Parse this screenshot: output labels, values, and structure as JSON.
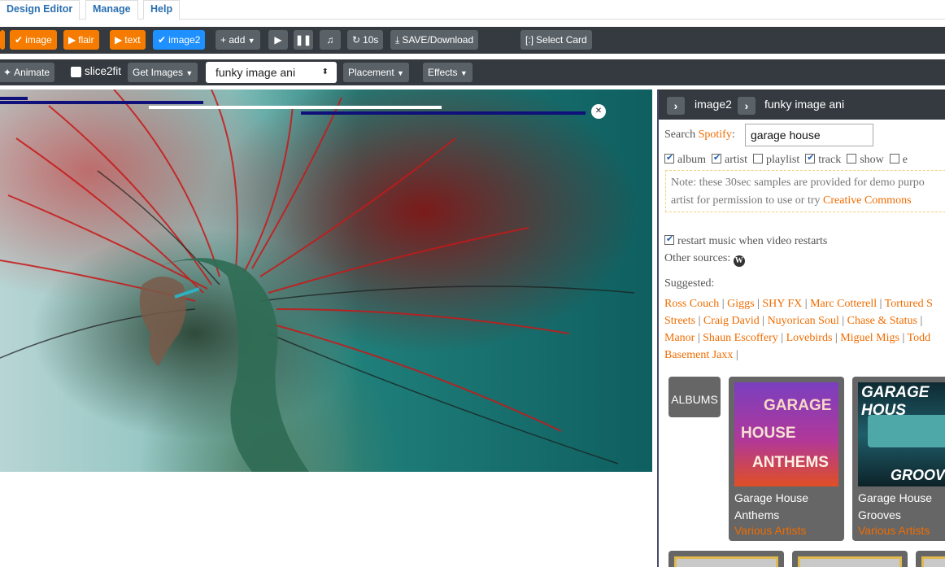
{
  "tabs": [
    "Design Editor",
    "Manage",
    "Help"
  ],
  "toolbar1": {
    "image": "image",
    "flair": "flair",
    "text": "text",
    "image2": "image2",
    "add": "+ add",
    "timer": "10s",
    "save": "SAVE/Download",
    "select_card": "Select Card"
  },
  "toolbar2": {
    "animate": "Animate",
    "slice2fit": "slice2fit",
    "get_images": "Get Images",
    "select_value": "funky image ani",
    "placement": "Placement",
    "effects": "Effects"
  },
  "panel": {
    "breadcrumb1": "image2",
    "breadcrumb2": "funky image ani",
    "search_label": "Search",
    "search_source": "Spotify",
    "search_value": "garage house",
    "filters": [
      {
        "label": "album",
        "checked": true
      },
      {
        "label": "artist",
        "checked": true
      },
      {
        "label": "playlist",
        "checked": false
      },
      {
        "label": "track",
        "checked": true
      },
      {
        "label": "show",
        "checked": false
      },
      {
        "label": "e",
        "checked": false
      }
    ],
    "note_line1": "Note: these 30sec samples are provided for demo purpo",
    "note_line2": "artist for permission to use or try",
    "note_link": "Creative Commons",
    "restart_label": "restart music when video restarts",
    "other_sources": "Other sources:",
    "suggested_label": "Suggested:",
    "suggested_lines": [
      [
        "Ross Couch",
        "Giggs",
        "SHY FX",
        "Marc Cotterell",
        "Tortured S"
      ],
      [
        "Streets",
        "Craig David",
        "Nuyorican Soul",
        "Chase & Status",
        ""
      ],
      [
        "Manor",
        "Shaun Escoffery",
        "Lovebirds",
        "Miguel Migs",
        "Todd"
      ],
      [
        "Basement Jaxx",
        ""
      ]
    ],
    "albums_tag": "ALBUMS",
    "albums": [
      {
        "art_line1": "GARAGE",
        "art_line2": "HOUSE",
        "art_line3": "ANTHEMS",
        "title": "Garage House Anthems",
        "artist": "Various Artists"
      },
      {
        "art_line1": "GARAGE HOUS",
        "art_line2": "GROOVES",
        "art_line3": "",
        "title": "Garage House Grooves",
        "artist": "Various Artists"
      }
    ]
  },
  "colors": {
    "toolbar": "#343a40",
    "orange": "#f57c00",
    "blue": "#1e90ff",
    "link": "#ef6c00"
  }
}
